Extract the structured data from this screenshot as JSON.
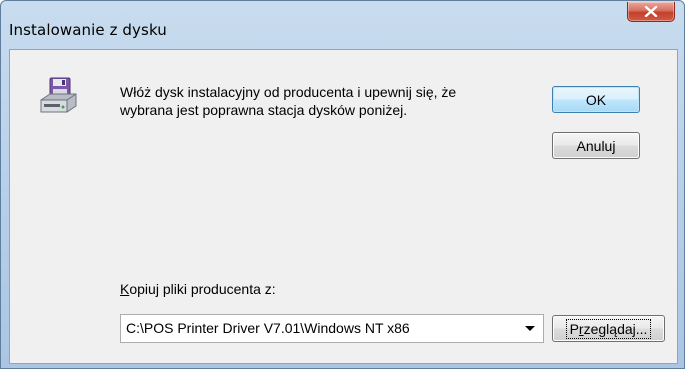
{
  "window": {
    "title": "Instalowanie z dysku",
    "close_icon": "close-icon"
  },
  "dialog": {
    "icon": "floppy-disk-drive-icon",
    "message_line1": "Włóż dysk instalacyjny od producenta i upewnij się, że",
    "message_line2": "wybrana jest poprawna stacja dysków poniżej.",
    "ok_label": "OK",
    "cancel_label": "Anuluj"
  },
  "copy_from": {
    "label_accel": "K",
    "label_rest": "opiuj pliki producenta z:",
    "path_value": "C:\\POS Printer Driver V7.01\\Windows NT x86",
    "browse_accel_before": "P",
    "browse_accel": "r",
    "browse_rest": "zeglądaj..."
  },
  "colors": {
    "titlebar": "#b9d1ea",
    "close_button": "#c2402c",
    "dialog_bg": "#f0f0f0",
    "default_button_border": "#3c7fb1"
  }
}
